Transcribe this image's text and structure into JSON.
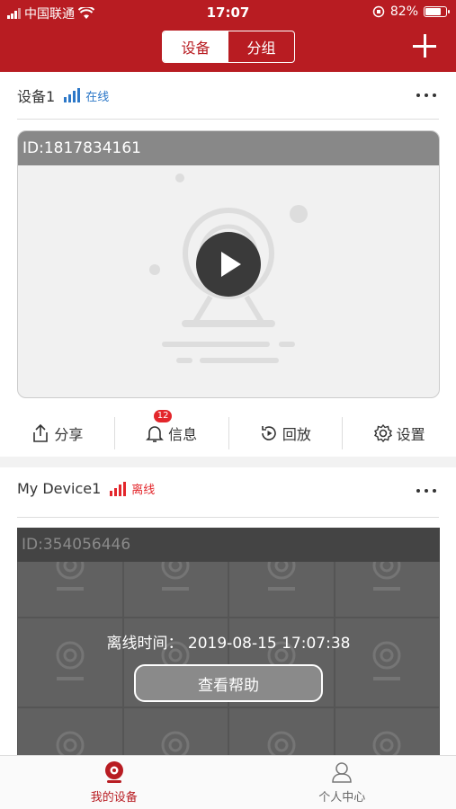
{
  "status_bar": {
    "carrier": "中国联通",
    "time": "17:07",
    "battery": "82%",
    "battery_level": 0.82
  },
  "header": {
    "tabs": [
      {
        "label": "设备",
        "active": true
      },
      {
        "label": "分组",
        "active": false
      }
    ],
    "add_icon": "plus-icon"
  },
  "devices": [
    {
      "name": "设备1",
      "status": "在线",
      "status_color": "#2d78c8",
      "id_label": "ID:1817834161",
      "actions": [
        {
          "label": "分享",
          "icon": "share-icon"
        },
        {
          "label": "信息",
          "icon": "bell-icon",
          "badge": "12"
        },
        {
          "label": "回放",
          "icon": "playback-icon"
        },
        {
          "label": "设置",
          "icon": "gear-icon"
        }
      ]
    },
    {
      "name": "My Device1",
      "status": "离线",
      "status_color": "#e3262b",
      "id_label": "ID:354056446",
      "offline_time": "离线时间：  2019-08-15 17:07:38",
      "help_label": "查看帮助"
    }
  ],
  "tabbar": {
    "items": [
      {
        "label": "我的设备",
        "icon": "camera-icon",
        "active": true
      },
      {
        "label": "个人中心",
        "icon": "user-icon",
        "active": false
      }
    ]
  },
  "colors": {
    "brand": "#b81c22",
    "online": "#2d78c8",
    "offline": "#e3262b"
  }
}
